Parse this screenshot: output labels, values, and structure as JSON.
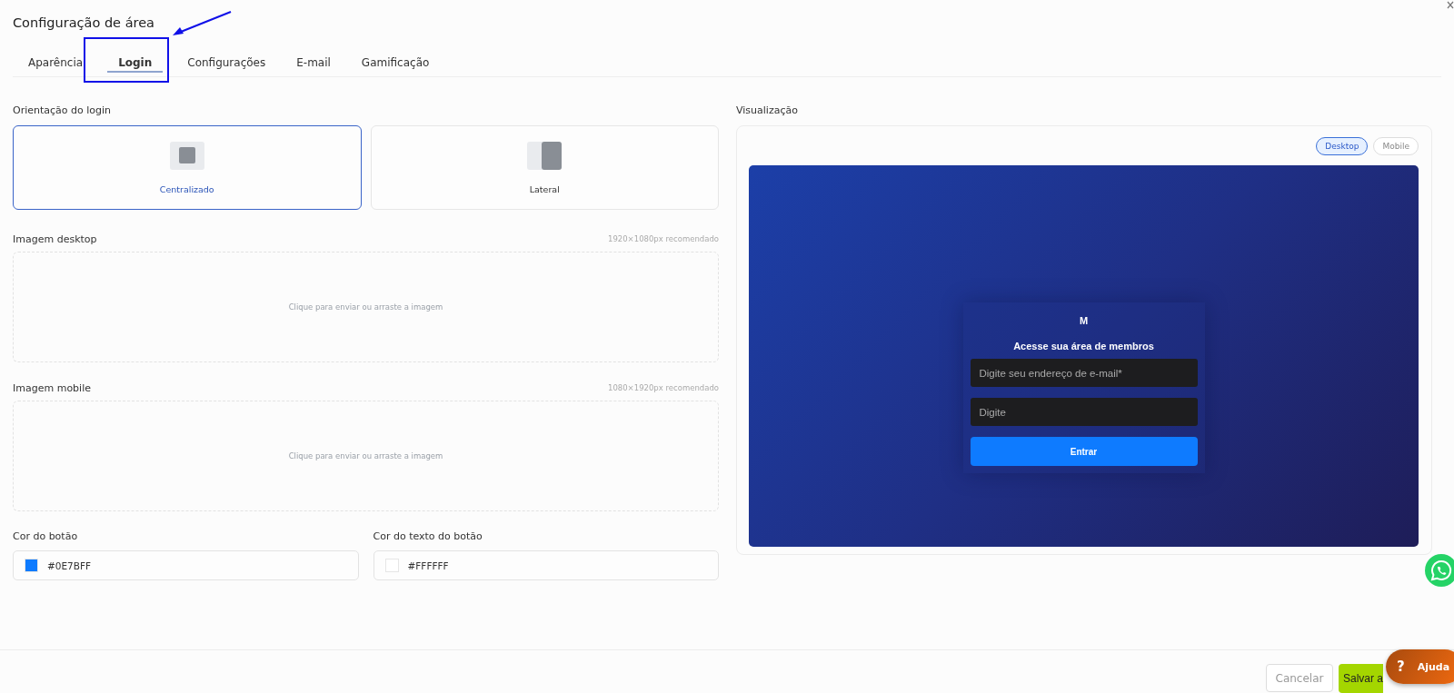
{
  "window": {
    "title": "Configuração de área"
  },
  "tabs": [
    {
      "label": "Aparência",
      "selected": false
    },
    {
      "label": "Login",
      "selected": true
    },
    {
      "label": "Configurações",
      "selected": false
    },
    {
      "label": "E-mail",
      "selected": false
    },
    {
      "label": "Gamificação",
      "selected": false
    }
  ],
  "orientation": {
    "label": "Orientação do login",
    "options": [
      {
        "kind": "centered",
        "label": "Centralizado",
        "selected": true
      },
      {
        "kind": "lateral",
        "label": "Lateral",
        "selected": false
      }
    ]
  },
  "uploads": [
    {
      "label": "Imagem desktop",
      "hint": "1920×1080px recomendado",
      "prompt": "Clique para enviar ou arraste a imagem"
    },
    {
      "label": "Imagem mobile",
      "hint": "1080×1920px recomendado",
      "prompt": "Clique para enviar ou arraste a imagem"
    }
  ],
  "colors": [
    {
      "label": "Cor do botão",
      "value": "#0E7BFF",
      "color": "#0e7bff"
    },
    {
      "label": "Cor do texto do botão",
      "value": "#FFFFFF",
      "color": "#ffffff"
    }
  ],
  "preview": {
    "label": "Visualização",
    "modes": [
      {
        "label": "Desktop",
        "selected": true
      },
      {
        "label": "Mobile",
        "selected": false
      }
    ],
    "logo": "M",
    "heading": "Acesse sua área de membros",
    "email_placeholder": "Digite seu endereço de e-mail*",
    "password_placeholder": "Digite",
    "button": "Entrar"
  },
  "footer": {
    "cancel": "Cancelar",
    "save": "Salvar a"
  },
  "help": {
    "label": "Ajuda",
    "icon": "?"
  }
}
